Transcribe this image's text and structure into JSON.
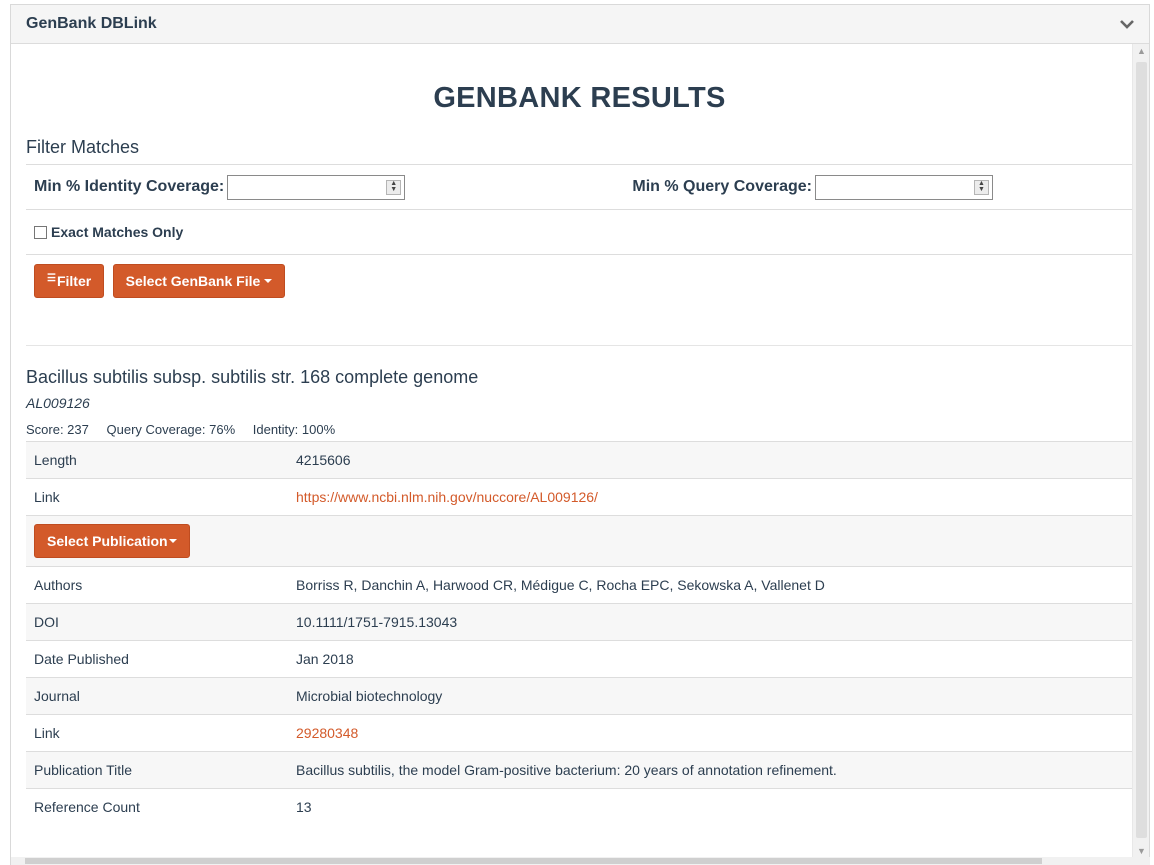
{
  "panel": {
    "title": "GenBank DBLink",
    "toggle_icon": "chevron-down-icon"
  },
  "heading": "GENBANK RESULTS",
  "filter": {
    "title": "Filter Matches",
    "identity_label": "Min % Identity Coverage:",
    "identity_value": "",
    "query_label": "Min % Query Coverage:",
    "query_value": "",
    "exact_label": "Exact Matches Only",
    "exact_checked": false,
    "filter_button": "Filter",
    "select_file_button": "Select GenBank File"
  },
  "result": {
    "title": "Bacillus subtilis subsp. subtilis str. 168 complete genome",
    "accession": "AL009126",
    "score": "Score: 237",
    "query_coverage": "Query Coverage: 76%",
    "identity": "Identity: 100%",
    "length_label": "Length",
    "length_value": "4215606",
    "link_label": "Link",
    "link_value": "https://www.ncbi.nlm.nih.gov/nuccore/AL009126/",
    "select_publication_button": "Select Publication",
    "publication": [
      {
        "label": "Authors",
        "value": "Borriss R, Danchin A, Harwood CR, Médigue C, Rocha EPC, Sekowska A, Vallenet D",
        "link": false
      },
      {
        "label": "DOI",
        "value": "10.1111/1751-7915.13043",
        "link": false
      },
      {
        "label": "Date Published",
        "value": "Jan 2018",
        "link": false
      },
      {
        "label": "Journal",
        "value": "Microbial biotechnology",
        "link": false
      },
      {
        "label": "Link",
        "value": "29280348",
        "link": true
      },
      {
        "label": "Publication Title",
        "value": "Bacillus subtilis, the model Gram-positive bacterium: 20 years of annotation refinement.",
        "link": false
      },
      {
        "label": "Reference Count",
        "value": "13",
        "link": false
      }
    ]
  },
  "colors": {
    "accent": "#d35a2a",
    "text": "#2c3e50"
  }
}
